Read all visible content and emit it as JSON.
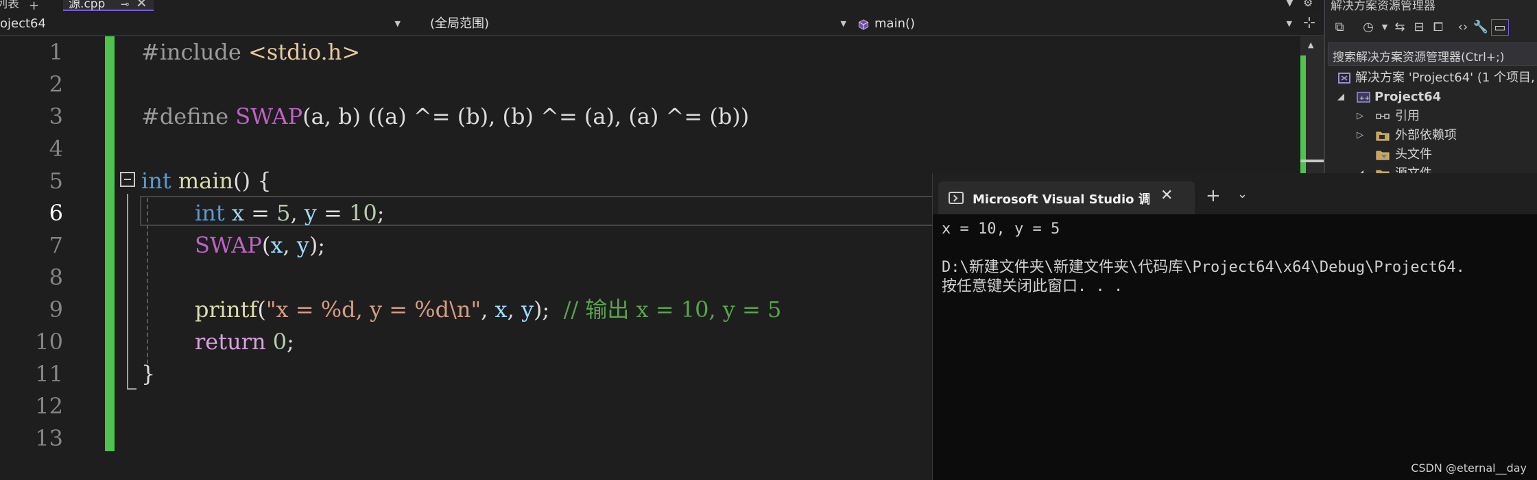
{
  "tabs": {
    "previous_tab_label": "列表",
    "active_tab_label": "源.cpp",
    "pin_glyph": "⊸",
    "close_glyph": "✕",
    "add_glyph": "+"
  },
  "navbar": {
    "project_label": "oject64",
    "scope_label": "(全局范围)",
    "member_label": "main()"
  },
  "editor": {
    "line_numbers": [
      "1",
      "2",
      "3",
      "4",
      "5",
      "6",
      "7",
      "8",
      "9",
      "10",
      "11",
      "12",
      "13"
    ],
    "current_line": 6,
    "code": {
      "l1_directive": "#include",
      "l1_header": "<stdio.h>",
      "l3_directive": "#define",
      "l3_macro": "SWAP",
      "l3_params": "(a, b) ((a) ^= (b), (b) ^= (a), (a) ^= (b))",
      "l5_keyword": "int",
      "l5_func": "main",
      "l5_rest": "() {",
      "l6_keyword": "int",
      "l6_var1": "x",
      "l6_eq1": " = ",
      "l6_num1": "5",
      "l6_comma": ", ",
      "l6_var2": "y",
      "l6_eq2": " = ",
      "l6_num2": "10",
      "l6_semi": ";",
      "l7_macro": "SWAP",
      "l7_open": "(",
      "l7_x": "x",
      "l7_comma": ", ",
      "l7_y": "y",
      "l7_close": ");",
      "l9_func": "printf",
      "l9_open": "(",
      "l9_string": "\"x = %d, y = %d\\n\"",
      "l9_comma1": ", ",
      "l9_x": "x",
      "l9_comma2": ", ",
      "l9_y": "y",
      "l9_close": ");",
      "l9_comment": "// 输出 x = 10, y = 5",
      "l10_keyword": "return",
      "l10_num": "0",
      "l10_semi": ";",
      "l11_brace": "}"
    }
  },
  "solution_explorer": {
    "title": "解决方案资源管理器",
    "search_placeholder": "搜索解决方案资源管理器(Ctrl+;)",
    "tree": [
      {
        "label": "解决方案 'Project64' (1 个项目,",
        "bold": false
      },
      {
        "label": "Project64",
        "bold": true
      },
      {
        "label": "引用",
        "bold": false
      },
      {
        "label": "外部依赖项",
        "bold": false
      },
      {
        "label": "头文件",
        "bold": false
      },
      {
        "label": "源文件",
        "bold": false
      }
    ]
  },
  "console": {
    "tab_title": "Microsoft Visual Studio 调试控制台",
    "output_lines": [
      "x = 10, y = 5",
      "",
      "D:\\新建文件夹\\新建文件夹\\代码库\\Project64\\x64\\Debug\\Project64.",
      "按任意键关闭此窗口. . ."
    ],
    "add_glyph": "+",
    "dropdown_glyph": "⌄"
  },
  "watermark": "CSDN @eternal__day",
  "colors": {
    "editor_bg": "#1e1e1e",
    "change_bar": "#4ec34e",
    "keyword": "#569cd6",
    "macro": "#bd63c5",
    "string": "#d69d85",
    "comment": "#57a64a",
    "function": "#dcdcaa",
    "variable": "#9cdcfe",
    "console_bg": "#0c0c0c"
  }
}
